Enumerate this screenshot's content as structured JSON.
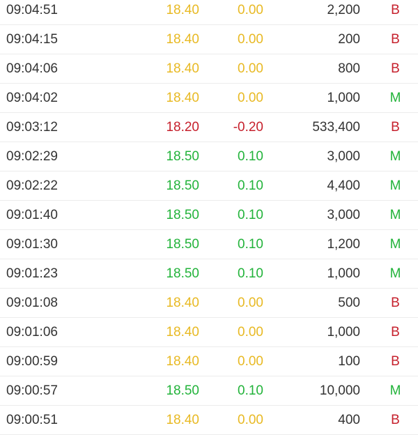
{
  "colors": {
    "flat": "#e8b923",
    "up": "#22b33a",
    "down": "#c6202c",
    "text": "#333333"
  },
  "trades": [
    {
      "time": "09:04:51",
      "price": "18.40",
      "change": "0.00",
      "volume": "2,200",
      "side": "B",
      "trend": "flat"
    },
    {
      "time": "09:04:15",
      "price": "18.40",
      "change": "0.00",
      "volume": "200",
      "side": "B",
      "trend": "flat"
    },
    {
      "time": "09:04:06",
      "price": "18.40",
      "change": "0.00",
      "volume": "800",
      "side": "B",
      "trend": "flat"
    },
    {
      "time": "09:04:02",
      "price": "18.40",
      "change": "0.00",
      "volume": "1,000",
      "side": "M",
      "trend": "flat"
    },
    {
      "time": "09:03:12",
      "price": "18.20",
      "change": "-0.20",
      "volume": "533,400",
      "side": "B",
      "trend": "down"
    },
    {
      "time": "09:02:29",
      "price": "18.50",
      "change": "0.10",
      "volume": "3,000",
      "side": "M",
      "trend": "up"
    },
    {
      "time": "09:02:22",
      "price": "18.50",
      "change": "0.10",
      "volume": "4,400",
      "side": "M",
      "trend": "up"
    },
    {
      "time": "09:01:40",
      "price": "18.50",
      "change": "0.10",
      "volume": "3,000",
      "side": "M",
      "trend": "up"
    },
    {
      "time": "09:01:30",
      "price": "18.50",
      "change": "0.10",
      "volume": "1,200",
      "side": "M",
      "trend": "up"
    },
    {
      "time": "09:01:23",
      "price": "18.50",
      "change": "0.10",
      "volume": "1,000",
      "side": "M",
      "trend": "up"
    },
    {
      "time": "09:01:08",
      "price": "18.40",
      "change": "0.00",
      "volume": "500",
      "side": "B",
      "trend": "flat"
    },
    {
      "time": "09:01:06",
      "price": "18.40",
      "change": "0.00",
      "volume": "1,000",
      "side": "B",
      "trend": "flat"
    },
    {
      "time": "09:00:59",
      "price": "18.40",
      "change": "0.00",
      "volume": "100",
      "side": "B",
      "trend": "flat"
    },
    {
      "time": "09:00:57",
      "price": "18.50",
      "change": "0.10",
      "volume": "10,000",
      "side": "M",
      "trend": "up"
    },
    {
      "time": "09:00:51",
      "price": "18.40",
      "change": "0.00",
      "volume": "400",
      "side": "B",
      "trend": "flat"
    }
  ]
}
